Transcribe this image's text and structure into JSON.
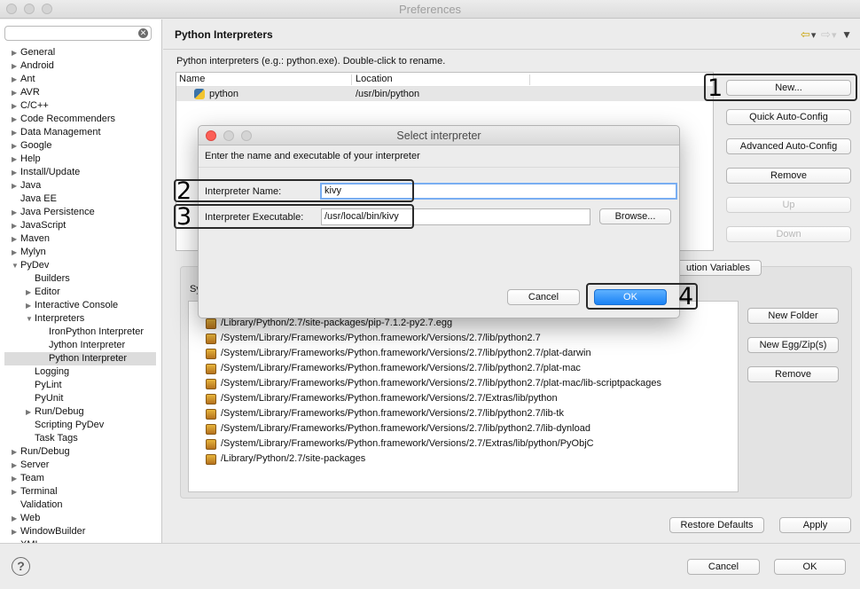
{
  "window": {
    "title": "Preferences"
  },
  "sidebar": {
    "filter_value": "",
    "items": [
      {
        "label": "General",
        "arrow": "▶"
      },
      {
        "label": "Android",
        "arrow": "▶"
      },
      {
        "label": "Ant",
        "arrow": "▶"
      },
      {
        "label": "AVR",
        "arrow": "▶"
      },
      {
        "label": "C/C++",
        "arrow": "▶"
      },
      {
        "label": "Code Recommenders",
        "arrow": "▶"
      },
      {
        "label": "Data Management",
        "arrow": "▶"
      },
      {
        "label": "Google",
        "arrow": "▶"
      },
      {
        "label": "Help",
        "arrow": "▶"
      },
      {
        "label": "Install/Update",
        "arrow": "▶"
      },
      {
        "label": "Java",
        "arrow": "▶"
      },
      {
        "label": "Java EE",
        "arrow": ""
      },
      {
        "label": "Java Persistence",
        "arrow": "▶"
      },
      {
        "label": "JavaScript",
        "arrow": "▶"
      },
      {
        "label": "Maven",
        "arrow": "▶"
      },
      {
        "label": "Mylyn",
        "arrow": "▶"
      },
      {
        "label": "PyDev",
        "arrow": "▼"
      },
      {
        "label": "Builders",
        "arrow": ""
      },
      {
        "label": "Editor",
        "arrow": "▶"
      },
      {
        "label": "Interactive Console",
        "arrow": "▶"
      },
      {
        "label": "Interpreters",
        "arrow": "▼"
      },
      {
        "label": "IronPython Interpreter",
        "arrow": ""
      },
      {
        "label": "Jython Interpreter",
        "arrow": ""
      },
      {
        "label": "Python Interpreter",
        "arrow": ""
      },
      {
        "label": "Logging",
        "arrow": ""
      },
      {
        "label": "PyLint",
        "arrow": ""
      },
      {
        "label": "PyUnit",
        "arrow": ""
      },
      {
        "label": "Run/Debug",
        "arrow": "▶"
      },
      {
        "label": "Scripting PyDev",
        "arrow": ""
      },
      {
        "label": "Task Tags",
        "arrow": ""
      },
      {
        "label": "Run/Debug",
        "arrow": "▶"
      },
      {
        "label": "Server",
        "arrow": "▶"
      },
      {
        "label": "Team",
        "arrow": "▶"
      },
      {
        "label": "Terminal",
        "arrow": "▶"
      },
      {
        "label": "Validation",
        "arrow": ""
      },
      {
        "label": "Web",
        "arrow": "▶"
      },
      {
        "label": "WindowBuilder",
        "arrow": "▶"
      },
      {
        "label": "XML",
        "arrow": "▶"
      }
    ]
  },
  "main": {
    "title": "Python Interpreters",
    "description": "Python interpreters (e.g.: python.exe).   Double-click to rename.",
    "table": {
      "headers": [
        "Name",
        "Location"
      ],
      "rows": [
        {
          "name": "python",
          "location": "/usr/bin/python"
        }
      ]
    },
    "buttons": {
      "new": "New...",
      "quick": "Quick Auto-Config",
      "advanced": "Advanced Auto-Config",
      "remove": "Remove",
      "up": "Up",
      "down": "Down"
    },
    "env_tab": "ution Variables",
    "sy_label": "Sy",
    "paths": [
      "/Library/Python/2.7/site-packages/pip-7.1.2-py2.7.egg",
      "/System/Library/Frameworks/Python.framework/Versions/2.7/lib/python2.7",
      "/System/Library/Frameworks/Python.framework/Versions/2.7/lib/python2.7/plat-darwin",
      "/System/Library/Frameworks/Python.framework/Versions/2.7/lib/python2.7/plat-mac",
      "/System/Library/Frameworks/Python.framework/Versions/2.7/lib/python2.7/plat-mac/lib-scriptpackages",
      "/System/Library/Frameworks/Python.framework/Versions/2.7/Extras/lib/python",
      "/System/Library/Frameworks/Python.framework/Versions/2.7/lib/python2.7/lib-tk",
      "/System/Library/Frameworks/Python.framework/Versions/2.7/lib/python2.7/lib-dynload",
      "/System/Library/Frameworks/Python.framework/Versions/2.7/Extras/lib/python/PyObjC",
      "/Library/Python/2.7/site-packages"
    ],
    "path_buttons": {
      "new_folder": "New Folder",
      "new_egg": "New Egg/Zip(s)",
      "remove": "Remove"
    },
    "restore_defaults": "Restore Defaults",
    "apply": "Apply"
  },
  "footer": {
    "cancel": "Cancel",
    "ok": "OK",
    "help_glyph": "?"
  },
  "dialog": {
    "title": "Select interpreter",
    "message": "Enter the name and executable of your interpreter",
    "name_label": "Interpreter Name:",
    "name_value": "kivy",
    "exe_label": "Interpreter Executable:",
    "exe_value": "/usr/local/bin/kivy",
    "browse": "Browse...",
    "cancel": "Cancel",
    "ok": "OK"
  },
  "callouts": [
    "1",
    "2",
    "3",
    "4"
  ],
  "colors": {
    "accent": "#1a82f5",
    "close_red": "#fc5f57",
    "selection": "#dcdcdc"
  }
}
